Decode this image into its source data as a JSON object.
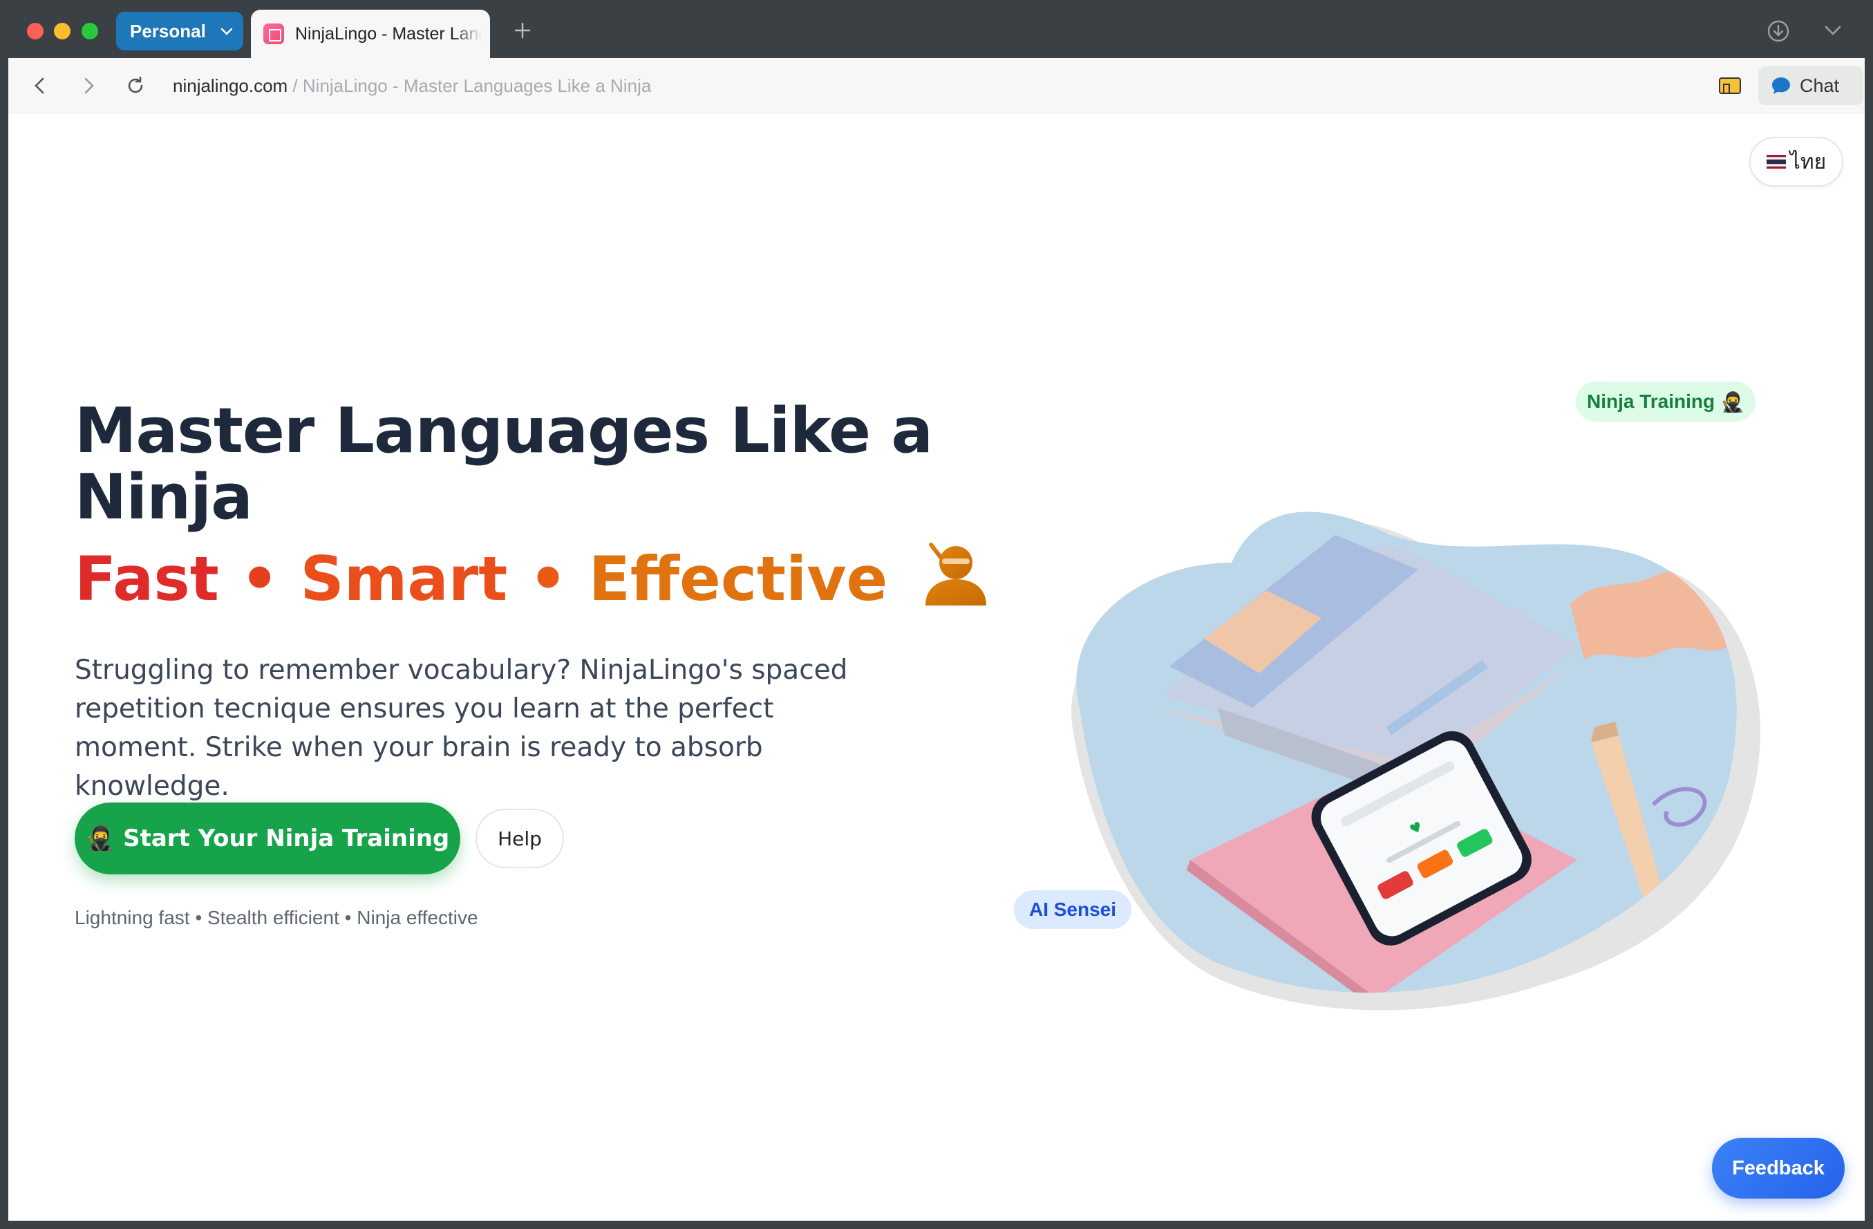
{
  "browser": {
    "profile_label": "Personal",
    "tab_title": "NinjaLingo - Master Languages Like a Ninja",
    "url_host": "ninjalingo.com",
    "url_separator": " / ",
    "url_path": "NinjaLingo - Master Languages Like a Ninja",
    "chat_label": "Chat"
  },
  "page": {
    "language_label": "ไทย",
    "hero_title": "Master Languages Like a Ninja",
    "hero_sub": {
      "fast": "Fast",
      "dot": "•",
      "smart": "Smart",
      "effective": "Effective"
    },
    "description": "Struggling to remember vocabulary? NinjaLingo's spaced repetition tecnique ensures you learn at the perfect moment. Strike when your brain is ready to absorb knowledge.",
    "cta_emoji": "🥷",
    "cta_label": "Start Your Ninja Training",
    "help_label": "Help",
    "tagline": "Lightning fast • Stealth efficient • Ninja effective",
    "badge_ninja": "Ninja Training",
    "badge_ninja_emoji": "🥷",
    "badge_ai": "AI Sensei",
    "feedback_label": "Feedback"
  },
  "colors": {
    "cta_green": "#17a34a",
    "title_dark": "#1e2a3c",
    "feedback_blue": "#2563eb",
    "profile_blue": "#1d77b8"
  },
  "icons": [
    "chevron-down-icon",
    "plus-icon",
    "download-icon",
    "back-icon",
    "forward-icon",
    "reload-icon",
    "extension-icon",
    "chat-bubble-icon",
    "thai-flag-icon",
    "ninja-icon"
  ]
}
